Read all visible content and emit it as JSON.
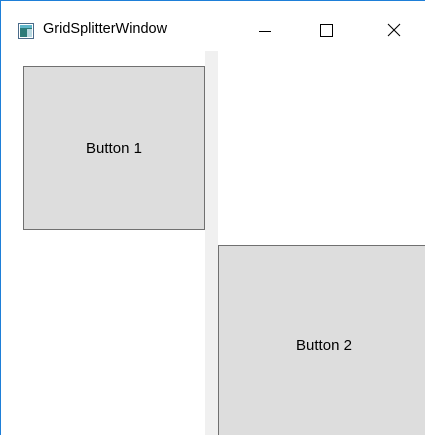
{
  "window": {
    "title": "GridSplitterWindow",
    "icon": "wpf-app-icon",
    "caption_buttons": {
      "minimize_icon": "minimize-icon",
      "maximize_icon": "maximize-icon",
      "close_icon": "close-icon"
    }
  },
  "content": {
    "button_1_label": "Button 1",
    "button_2_label": "Button 2"
  },
  "colors": {
    "window_border": "#1e7fd8",
    "button_background": "#dddddd",
    "button_border": "#707070",
    "splitter": "#f0f0f0"
  }
}
